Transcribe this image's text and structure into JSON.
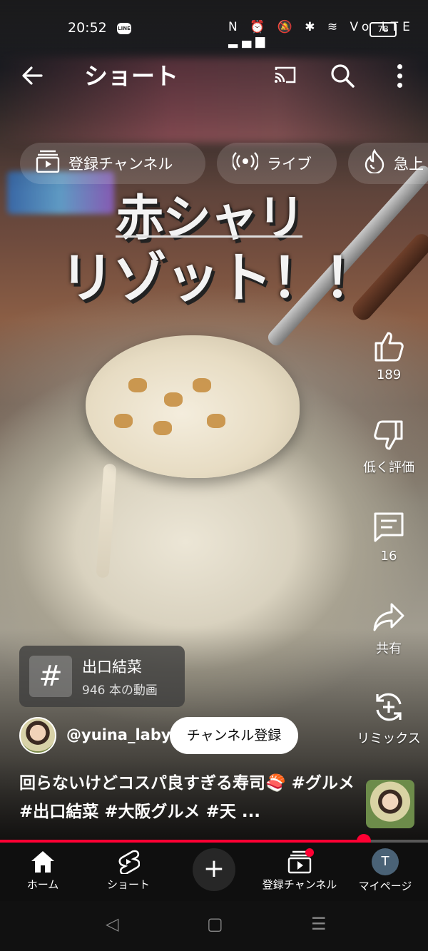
{
  "status_bar": {
    "time": "20:52",
    "line_badge": "LINE",
    "icons": "N ⏰ 🔕 ✱ ≋ Vo LTE ▂▄▆",
    "battery": "78"
  },
  "app_bar": {
    "title": "ショート"
  },
  "chips": [
    {
      "label": "登録チャンネル"
    },
    {
      "label": "ライブ"
    },
    {
      "label": "急上"
    }
  ],
  "video_caption": {
    "line1": "赤シャリ",
    "line2": "リゾット！！"
  },
  "actions": {
    "like_count": "189",
    "dislike_label": "低く評価",
    "comment_count": "16",
    "share_label": "共有",
    "remix_label": "リミックス"
  },
  "hashtag_card": {
    "symbol": "#",
    "name": "出口結菜",
    "video_count": "946 本の動画"
  },
  "channel": {
    "handle": "@yuina_laby",
    "subscribe_label": "チャンネル登録"
  },
  "description": "回らないけどコスパ良すぎる寿司🍣 #グルメ #出口結菜 #大阪グルメ #天 ...",
  "progress": {
    "fraction": 0.85,
    "color": "#ff0033"
  },
  "bottom_nav": {
    "home": "ホーム",
    "shorts": "ショート",
    "create": "+",
    "subscriptions": "登録チャンネル",
    "profile": "マイページ",
    "profile_initial": "T"
  },
  "system_nav": {
    "back": "◁",
    "home": "▢",
    "recents": "☰"
  }
}
